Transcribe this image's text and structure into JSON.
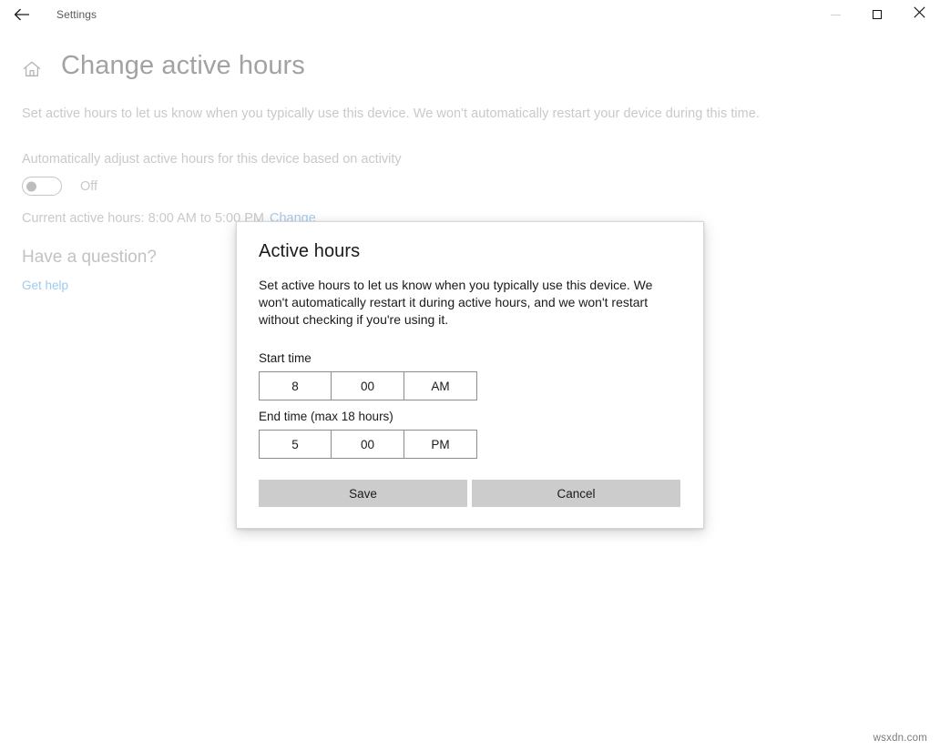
{
  "window": {
    "app_title": "Settings",
    "back_icon": "back-arrow-icon",
    "minimize_label": "—",
    "maximize_label": "□",
    "close_label": "✕"
  },
  "page": {
    "home_icon": "home-icon",
    "title": "Change active hours",
    "description": "Set active hours to let us know when you typically use this device. We won't automatically restart your device during this time.",
    "auto_adjust_label": "Automatically adjust active hours for this device based on activity",
    "toggle_state": "Off",
    "current_hours_text": "Current active hours: 8:00 AM to 5:00 PM",
    "change_link": "Change",
    "question_heading": "Have a question?",
    "get_help_link": "Get help"
  },
  "dialog": {
    "title": "Active hours",
    "description": "Set active hours to let us know when you typically use this device. We won't automatically restart it during active hours, and we won't restart without checking if you're using it.",
    "start_label": "Start time",
    "end_label": "End time (max 18 hours)",
    "start_time": {
      "hour": "8",
      "minute": "00",
      "period": "AM"
    },
    "end_time": {
      "hour": "5",
      "minute": "00",
      "period": "PM"
    },
    "save_label": "Save",
    "cancel_label": "Cancel"
  },
  "watermark": "wsxdn.com",
  "colors": {
    "accent_link": "#9ecbee",
    "dimmed_text": "#c9c9c9",
    "dialog_text": "#1a1a1a",
    "button_bg": "#cccccc",
    "field_border": "#8c8c8c"
  }
}
